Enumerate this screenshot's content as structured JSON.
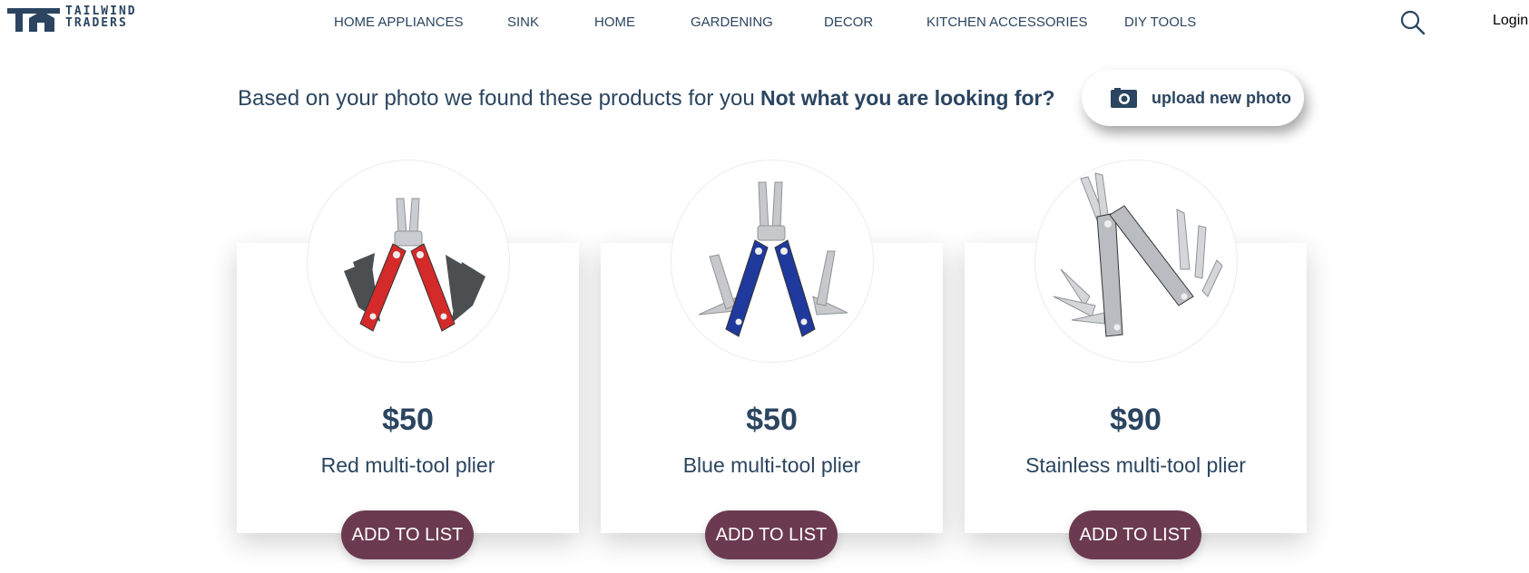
{
  "brand": {
    "line1": "TAILWIND",
    "line2": "TRADERS"
  },
  "nav": [
    {
      "label": "HOME APPLIANCES"
    },
    {
      "label": "SINK"
    },
    {
      "label": "HOME"
    },
    {
      "label": "GARDENING"
    },
    {
      "label": "DECOR"
    },
    {
      "label": "KITCHEN ACCESSORIES"
    },
    {
      "label": "DIY TOOLS"
    }
  ],
  "header": {
    "search_icon": "search-icon",
    "login_label": "Login"
  },
  "results": {
    "intro": "Based on your photo we found these products for you",
    "prompt": "Not what you are looking for?",
    "upload_label": "upload new photo",
    "upload_icon": "camera-icon"
  },
  "products": [
    {
      "price": "$50",
      "name": "Red multi-tool plier",
      "button": "ADD TO LIST",
      "color": "#d42a2a"
    },
    {
      "price": "$50",
      "name": "Blue multi-tool plier",
      "button": "ADD TO LIST",
      "color": "#1f3a9c"
    },
    {
      "price": "$90",
      "name": "Stainless multi-tool plier",
      "button": "ADD TO LIST",
      "color": "#b9bcc0"
    }
  ],
  "colors": {
    "text": "#2b4560",
    "button": "#6b3a50"
  }
}
